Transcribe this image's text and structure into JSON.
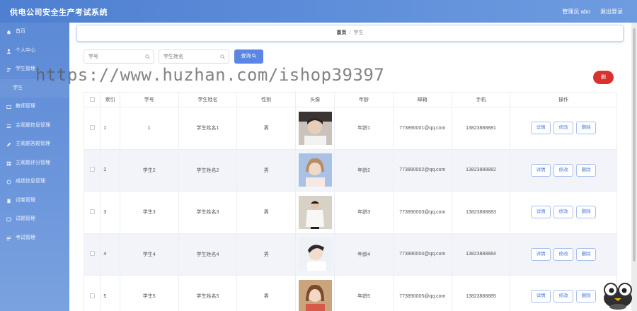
{
  "app": {
    "title": "供电公司安全生产考试系统",
    "user": "管理员 abo",
    "logout": "退出登录"
  },
  "sidebar": {
    "items": [
      {
        "label": "首页",
        "icon": "home-icon"
      },
      {
        "label": "个人中心",
        "icon": "user-icon"
      },
      {
        "label": "学生管理",
        "icon": "people-icon"
      },
      {
        "label": "学生",
        "icon": ""
      },
      {
        "label": "教师管理",
        "icon": "teacher-icon"
      },
      {
        "label": "主观题信息管理",
        "icon": "list-icon"
      },
      {
        "label": "主观题答题管理",
        "icon": "edit-icon"
      },
      {
        "label": "主观题评分管理",
        "icon": "grid-icon"
      },
      {
        "label": "成绩信息管理",
        "icon": "chart-icon"
      },
      {
        "label": "试卷管理",
        "icon": "doc-icon"
      },
      {
        "label": "试题管理",
        "icon": "question-icon"
      },
      {
        "label": "考试管理",
        "icon": "exam-icon"
      }
    ]
  },
  "breadcrumb": {
    "home": "首页",
    "separator": "/",
    "current": "学生"
  },
  "search": {
    "field1_placeholder": "学号",
    "field2_placeholder": "学生姓名",
    "query_label": "查询"
  },
  "toolbar": {
    "delete_label": "删"
  },
  "watermark": "https://www.huzhan.com/ishop39397",
  "table": {
    "columns": [
      "",
      "索引",
      "学号",
      "学生姓名",
      "性别",
      "头像",
      "年龄",
      "邮箱",
      "手机",
      "操作"
    ],
    "rows": [
      {
        "index": "1",
        "student_no": "1",
        "name": "学生姓名1",
        "gender": "男",
        "age": "年龄1",
        "email": "773890001@qq.com",
        "phone": "13823888881"
      },
      {
        "index": "2",
        "student_no": "学生2",
        "name": "学生姓名2",
        "gender": "男",
        "age": "年龄2",
        "email": "773890002@qq.com",
        "phone": "13823888882"
      },
      {
        "index": "3",
        "student_no": "学生3",
        "name": "学生姓名3",
        "gender": "男",
        "age": "年龄3",
        "email": "773890003@qq.com",
        "phone": "13823888883"
      },
      {
        "index": "4",
        "student_no": "学生4",
        "name": "学生姓名4",
        "gender": "男",
        "age": "年龄4",
        "email": "773890004@qq.com",
        "phone": "13823888884"
      },
      {
        "index": "5",
        "student_no": "学生5",
        "name": "学生姓名5",
        "gender": "男",
        "age": "年龄5",
        "email": "773890005@qq.com",
        "phone": "13823888885"
      }
    ],
    "actions": {
      "detail": "详情",
      "edit": "修改",
      "delete": "删除"
    }
  },
  "colors": {
    "topbar": "#4e7fd0",
    "sidebar": "#6d97dc",
    "primary": "#5b86e5",
    "danger": "#d9322c",
    "alt_row": "#f2f4fa"
  }
}
